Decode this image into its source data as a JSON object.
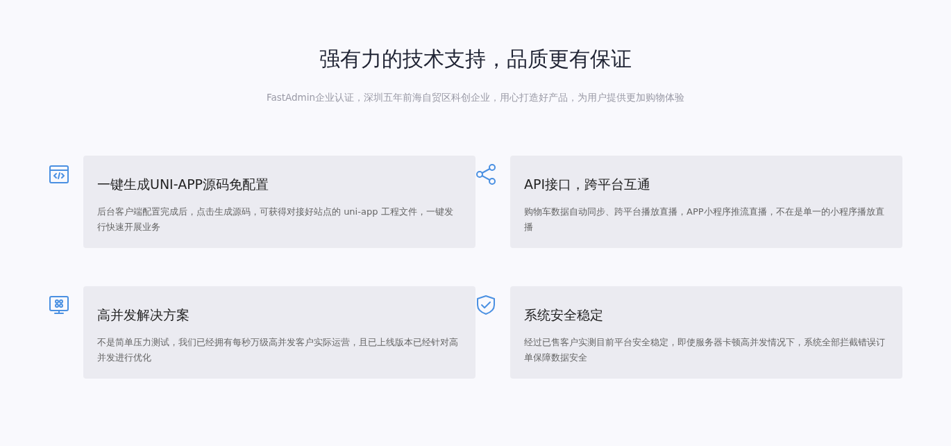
{
  "heading": "强有力的技术支持，品质更有保证",
  "subheading": "FastAdmin企业认证，深圳五年前海自贸区科创企业，用心打造好产品，为用户提供更加购物体验",
  "features": [
    {
      "title": "一键生成UNI-APP源码免配置",
      "description": "后台客户端配置完成后，点击生成源码，可获得对接好站点的 uni-app 工程文件，一键发行快速开展业务"
    },
    {
      "title": "API接口，跨平台互通",
      "description": "购物车数据自动同步、跨平台播放直播，APP小程序推流直播，不在是单一的小程序播放直播"
    },
    {
      "title": "高并发解决方案",
      "description": "不是简单压力测试，我们已经拥有每秒万级高并发客户实际运营，且已上线版本已经针对高并发进行优化"
    },
    {
      "title": "系统安全稳定",
      "description": "经过已售客户实测目前平台安全稳定，即使服务器卡顿高并发情况下，系统全部拦截错误订单保障数据安全"
    }
  ]
}
